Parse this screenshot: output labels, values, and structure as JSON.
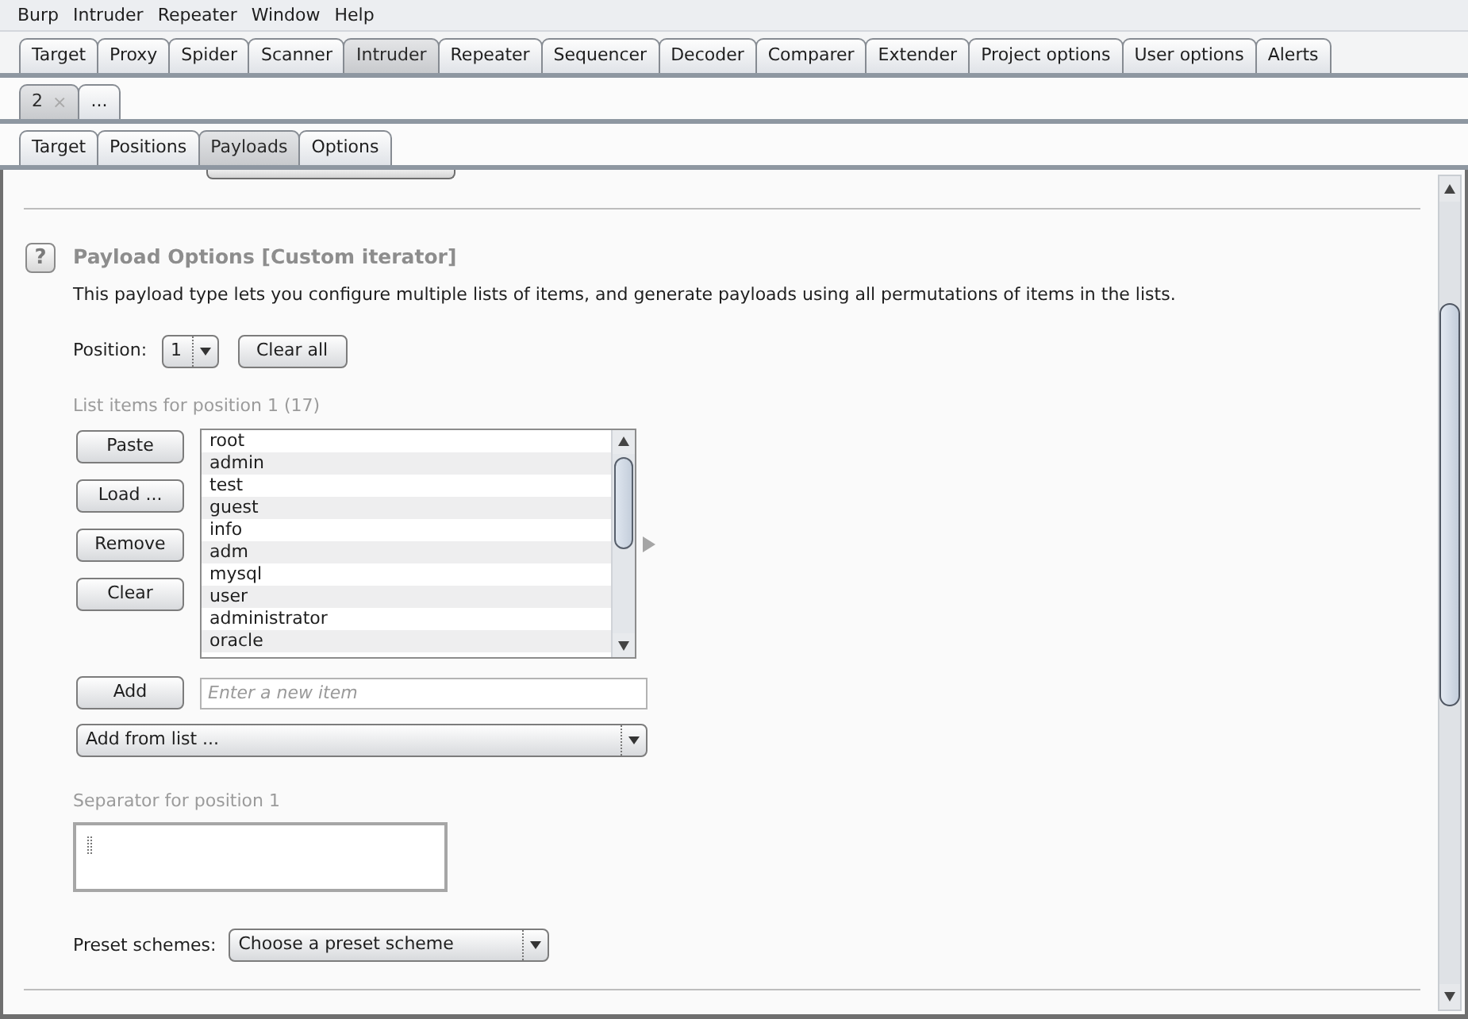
{
  "menu_bar": [
    "Burp",
    "Intruder",
    "Repeater",
    "Window",
    "Help"
  ],
  "main_tabs": [
    {
      "label": "Target",
      "selected": false
    },
    {
      "label": "Proxy",
      "selected": false
    },
    {
      "label": "Spider",
      "selected": false
    },
    {
      "label": "Scanner",
      "selected": false
    },
    {
      "label": "Intruder",
      "selected": true
    },
    {
      "label": "Repeater",
      "selected": false
    },
    {
      "label": "Sequencer",
      "selected": false
    },
    {
      "label": "Decoder",
      "selected": false
    },
    {
      "label": "Comparer",
      "selected": false
    },
    {
      "label": "Extender",
      "selected": false
    },
    {
      "label": "Project options",
      "selected": false
    },
    {
      "label": "User options",
      "selected": false
    },
    {
      "label": "Alerts",
      "selected": false
    }
  ],
  "attack_tabs": [
    {
      "label": "2",
      "close": "×",
      "selected": true
    },
    {
      "label": "...",
      "selected": false
    }
  ],
  "intruder_tabs": [
    {
      "label": "Target",
      "selected": false
    },
    {
      "label": "Positions",
      "selected": false
    },
    {
      "label": "Payloads",
      "selected": true
    },
    {
      "label": "Options",
      "selected": false
    }
  ],
  "payload_options": {
    "help_button": "?",
    "title": "Payload Options [Custom iterator]",
    "description": "This payload type lets you configure multiple lists of items, and generate payloads using all permutations of items in the lists.",
    "position_label": "Position:",
    "position_select": {
      "value": "1"
    },
    "clear_all_button": "Clear all",
    "list_label": "List items for position 1 (17)",
    "paste_button": "Paste",
    "load_button": "Load ...",
    "remove_button": "Remove",
    "clear_button": "Clear",
    "list_items": [
      {
        "text": "root",
        "selected": false
      },
      {
        "text": "admin",
        "selected": false
      },
      {
        "text": "test",
        "selected": false
      },
      {
        "text": "guest",
        "selected": false
      },
      {
        "text": "info",
        "selected": false
      },
      {
        "text": "adm",
        "selected": false
      },
      {
        "text": "mysql",
        "selected": false
      },
      {
        "text": "user",
        "selected": false
      },
      {
        "text": "administrator",
        "selected": false
      },
      {
        "text": "oracle",
        "selected": false
      }
    ],
    "add_button": "Add",
    "new_item_field": {
      "placeholder": "Enter a new item"
    },
    "add_from_list_select": {
      "value": "Add from list ..."
    },
    "separator_label": "Separator for position 1",
    "preset_label": "Preset schemes:",
    "preset_select": {
      "value": "Choose a preset scheme"
    }
  }
}
